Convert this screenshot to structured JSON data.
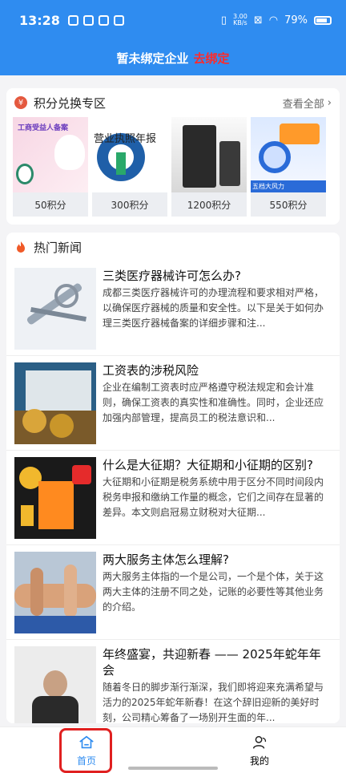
{
  "status_bar": {
    "time": "13:28",
    "speed_value": "3.00",
    "speed_unit": "KB/s",
    "battery": "79%"
  },
  "header": {
    "text": "暂未绑定企业",
    "action": "去绑定"
  },
  "points_section": {
    "icon": "yen-icon",
    "title": "积分兑换专区",
    "see_all": "查看全部",
    "products": [
      {
        "price": "50积分",
        "img_text": "工商受益人备案"
      },
      {
        "price": "300积分",
        "img_text": "营业执照年报"
      },
      {
        "price": "1200积分"
      },
      {
        "price": "550积分",
        "img_text": "五档大风力"
      }
    ]
  },
  "news_section": {
    "title": "热门新闻",
    "items": [
      {
        "title": "三类医疗器械许可怎么办?",
        "desc": "成都三类医疗器械许可的办理流程和要求相对严格，以确保医疗器械的质量和安全性。以下是关于如何办理三类医疗器械备案的详细步骤和注..."
      },
      {
        "title": "工资表的涉税风险",
        "desc": "企业在编制工资表时应严格遵守税法规定和会计准则，确保工资表的真实性和准确性。同时，企业还应加强内部管理，提高员工的税法意识和..."
      },
      {
        "title": "什么是大征期？大征期和小征期的区别?",
        "desc": "大征期和小征期是税务系统中用于区分不同时间段内税务申报和缴纳工作量的概念，它们之间存在显著的差异。本文则启冠易立财税对大征期..."
      },
      {
        "title": "两大服务主体怎么理解?",
        "desc": "两大服务主体指的一个是公司，一个是个体，关于这两大主体的注册不同之处，记账的必要性等其他业务的介绍。"
      },
      {
        "title": "年终盛宴，共迎新春 —— 2025年蛇年年会",
        "desc": "随着冬日的脚步渐行渐深，我们即将迎来充满希望与活力的2025年蛇年新春！在这个辞旧迎新的美好时刻，公司精心筹备了一场别开生面的年..."
      }
    ]
  },
  "tabbar": {
    "home": "首页",
    "mine": "我的"
  },
  "colors": {
    "brand": "#2f8cf0",
    "alert": "#ff2a2a"
  }
}
